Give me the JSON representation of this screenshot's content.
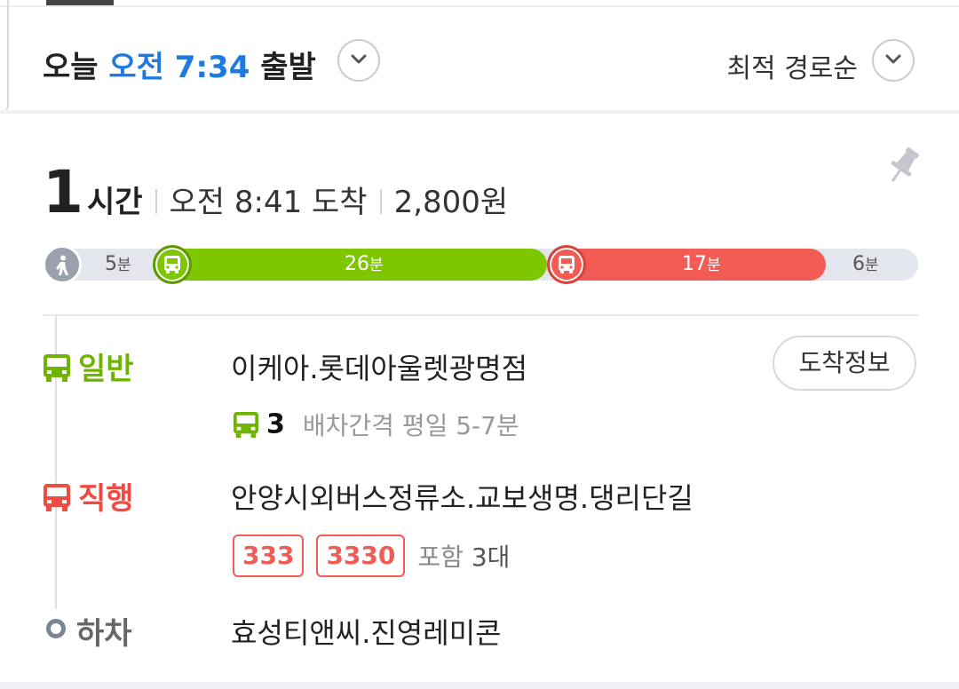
{
  "header": {
    "day": "오늘",
    "time": "오전 7:34",
    "suffix": "출발",
    "sort_label": "최적 경로순"
  },
  "summary": {
    "duration_number": "1",
    "duration_unit": "시간",
    "arrival": "오전 8:41 도착",
    "fare": "2,800원"
  },
  "timeline": {
    "segments": [
      {
        "mode": "walk",
        "minutes": "5",
        "unit": "분",
        "color": "#9aa1ac"
      },
      {
        "mode": "bus-general",
        "minutes": "26",
        "unit": "분",
        "color": "#7ec600"
      },
      {
        "mode": "bus-express",
        "minutes": "17",
        "unit": "분",
        "color": "#f25c54"
      },
      {
        "mode": "walk",
        "minutes": "6",
        "unit": "분",
        "color": "#9aa1ac"
      }
    ]
  },
  "steps": {
    "general": {
      "type": "일반",
      "station": "이케아.롯데아울렛광명점",
      "route": "3",
      "interval": "배차간격 평일 5-7분",
      "arrive_button": "도착정보",
      "color": "#6fb400"
    },
    "express": {
      "type": "직행",
      "station": "안양시외버스정류소.교보생명.댕리단길",
      "routes": [
        "333",
        "3330"
      ],
      "include_prefix": "포함",
      "include_count": "3대",
      "color": "#f04b43"
    },
    "alight": {
      "type": "하차",
      "station": "효성티앤씨.진영레미콘"
    }
  },
  "icons": {
    "chevron": "chevron-down-icon",
    "pin": "pin-icon",
    "walk": "walk-icon",
    "bus": "bus-icon"
  }
}
